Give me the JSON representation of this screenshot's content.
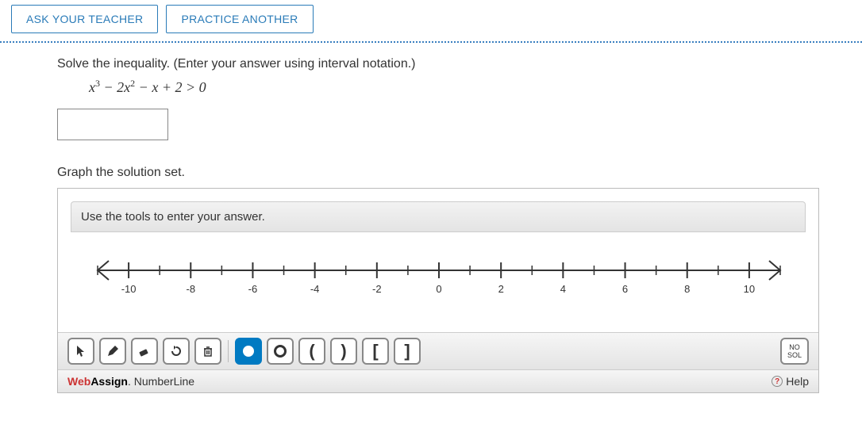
{
  "buttons": {
    "ask": "ASK YOUR TEACHER",
    "practice": "PRACTICE ANOTHER"
  },
  "prompt": "Solve the inequality. (Enter your answer using interval notation.)",
  "equation": {
    "lhs_terms": [
      "x",
      "3",
      " − 2",
      "x",
      "2",
      " − ",
      "x",
      " + 2 > 0"
    ]
  },
  "answer_value": "",
  "graph_label": "Graph the solution set.",
  "panel_header": "Use the tools to enter your answer.",
  "numberline": {
    "min": -11,
    "max": 11,
    "labels": [
      -10,
      -8,
      -6,
      -4,
      -2,
      0,
      2,
      4,
      6,
      8,
      10
    ]
  },
  "tools": {
    "pointer": "pointer-icon",
    "pencil": "pencil-icon",
    "eraser": "eraser-icon",
    "undo": "undo-icon",
    "trash": "trash-icon",
    "filled": "filled-point-icon",
    "open": "open-point-icon",
    "lparen": "(",
    "rparen": ")",
    "lbrack": "[",
    "rbrack": "]",
    "nosol1": "NO",
    "nosol2": "SOL"
  },
  "brand": {
    "web": "Web",
    "assign": "Assign",
    "dot": ".",
    "nl": "NumberLine"
  },
  "help": "Help"
}
